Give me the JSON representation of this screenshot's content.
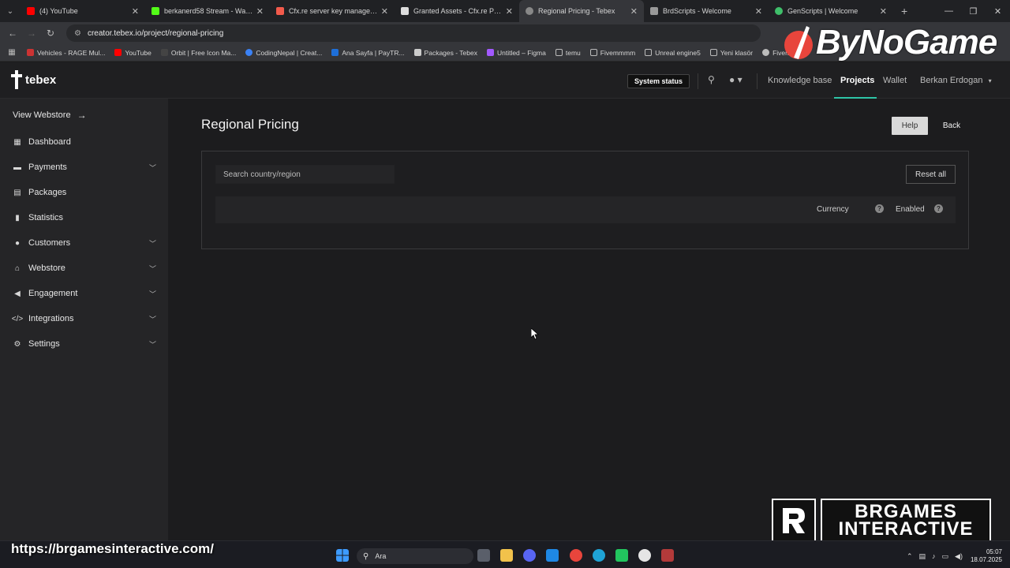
{
  "browser": {
    "tabs": [
      {
        "label": "(4) YouTube",
        "color": "#ff0000"
      },
      {
        "label": "berkanerd58 Stream - Watch Li",
        "color": "#53fc18"
      },
      {
        "label": "Cfx.re server key management",
        "color": "#f25a4b"
      },
      {
        "label": "Granted Assets - Cfx.re Portal",
        "color": "#ffffff"
      },
      {
        "label": "Regional Pricing - Tebex",
        "color": "#aaaaaa"
      },
      {
        "label": "BrdScripts - Welcome",
        "color": "#bbbbbb"
      },
      {
        "label": "GenScripts | Welcome",
        "color": "#3fbf6a"
      }
    ],
    "url": "creator.tebex.io/project/regional-pricing",
    "bookmarks": [
      {
        "label": "Vehicles - RAGE Mul...",
        "color": "#cc3333"
      },
      {
        "label": "YouTube",
        "color": "#ff0000"
      },
      {
        "label": "Orbit | Free Icon Ma...",
        "color": "#222222"
      },
      {
        "label": "CodingNepal | Creat...",
        "color": "#3b82f6"
      },
      {
        "label": "Ana Sayfa | PayTR...",
        "color": "#1e6fd9"
      },
      {
        "label": "Packages - Tebex",
        "color": "#cccccc"
      },
      {
        "label": "Untitled – Figma",
        "color": "#a259ff"
      },
      {
        "label": "temu",
        "color": "#888888"
      },
      {
        "label": "Fivemmmm",
        "color": "#888888"
      },
      {
        "label": "Unreal engine5",
        "color": "#888888"
      },
      {
        "label": "Yeni klasör",
        "color": "#888888"
      },
      {
        "label": "Fivem Scrip",
        "color": "#bbbbbb"
      }
    ]
  },
  "overlay": {
    "brand_top": "ByNoGame",
    "brand_bottom_line1": "BRGAMES",
    "brand_bottom_line2": "INTERACTIVE",
    "promo_url": "https://brgamesinteractive.com/"
  },
  "header": {
    "logo": "tebex",
    "system_status": "System status",
    "links": {
      "knowledge_base": "Knowledge base",
      "projects": "Projects",
      "wallet": "Wallet",
      "user": "Berkan Erdogan"
    },
    "accent": "#2ec4a6"
  },
  "sidebar": {
    "view_webstore": "View Webstore",
    "items": [
      {
        "label": "Dashboard",
        "icon": "dashboard-icon",
        "expandable": false
      },
      {
        "label": "Payments",
        "icon": "payments-icon",
        "expandable": true
      },
      {
        "label": "Packages",
        "icon": "packages-icon",
        "expandable": false
      },
      {
        "label": "Statistics",
        "icon": "statistics-icon",
        "expandable": false
      },
      {
        "label": "Customers",
        "icon": "customers-icon",
        "expandable": true
      },
      {
        "label": "Webstore",
        "icon": "webstore-icon",
        "expandable": true
      },
      {
        "label": "Engagement",
        "icon": "engagement-icon",
        "expandable": true
      },
      {
        "label": "Integrations",
        "icon": "integrations-icon",
        "expandable": true
      },
      {
        "label": "Settings",
        "icon": "settings-icon",
        "expandable": true
      }
    ]
  },
  "main": {
    "title": "Regional Pricing",
    "help": "Help",
    "back": "Back",
    "search_placeholder": "Search country/region",
    "reset_all": "Reset all",
    "columns": {
      "currency": "Currency",
      "enabled": "Enabled"
    }
  },
  "taskbar": {
    "search": "Ara",
    "time": "05:07",
    "date": "18.07.2025"
  }
}
